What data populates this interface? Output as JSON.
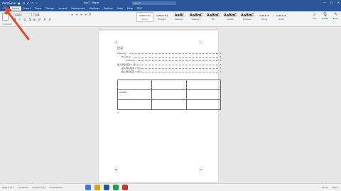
{
  "titlebar": {
    "quick_access": [
      "AutoSave",
      "●",
      "⎌",
      "↶",
      "↷",
      "⌄"
    ],
    "doc_title": "doc2 · Word",
    "search_placeholder": "Search",
    "window_controls": [
      "—",
      "□",
      "✕"
    ]
  },
  "tabs": [
    "File",
    "Home",
    "Insert",
    "Draw",
    "Design",
    "Layout",
    "References",
    "Mailings",
    "Review",
    "View",
    "Help",
    "PDF"
  ],
  "active_tab_index": 1,
  "ribbon": {
    "clipboard_label": "Clipboard",
    "font_name": "Calibri",
    "font_size": "10.5",
    "format_buttons": [
      "B",
      "I",
      "U",
      "S",
      "x₂",
      "x²",
      "A",
      "A"
    ],
    "paragraph_buttons": [
      "≡",
      "≡",
      "≡",
      "≡",
      "¶"
    ],
    "styles": [
      {
        "sample": "AaBbCcDd",
        "name": "Normal",
        "small": true
      },
      {
        "sample": "AaBbCcDd",
        "name": "No Spac.",
        "small": true
      },
      {
        "sample": "AaBl",
        "name": "Heading 1",
        "small": false
      },
      {
        "sample": "AaBbC",
        "name": "Heading 2",
        "small": false
      },
      {
        "sample": "AaBbC",
        "name": "Title",
        "small": false
      },
      {
        "sample": "AaBbC",
        "name": "Subtitle",
        "small": false
      },
      {
        "sample": "AaBbC",
        "name": "Emphasis",
        "small": false
      },
      {
        "sample": "AaBbCcD",
        "name": "Strong",
        "small": true
      },
      {
        "sample": "AaBbCcD",
        "name": "Quote",
        "small": true
      }
    ],
    "right_tools": [
      {
        "icon": "⌕",
        "label": "Find"
      },
      {
        "icon": "🎙",
        "label": "Dictate"
      },
      {
        "icon": "✎",
        "label": "Editor"
      }
    ]
  },
  "document": {
    "toc_title": "目录",
    "toc_lines": [
      {
        "text": "Heading",
        "indent": 0,
        "num": "1"
      },
      {
        "text": "Heading",
        "indent": 6,
        "num": "1"
      },
      {
        "text": "Heading",
        "indent": 12,
        "num": "1"
      },
      {
        "text": "插入题注段落 1 (无)",
        "indent": 0,
        "num": "1"
      },
      {
        "text": "插入题注段落 2 (无)",
        "indent": 6,
        "num": "1"
      },
      {
        "text": "插入题注段落 3 (无)",
        "indent": 6,
        "num": "1"
      }
    ],
    "table_rows": [
      [
        "",
        "",
        ""
      ],
      [
        "123456",
        "",
        ""
      ],
      [
        "",
        "",
        ""
      ]
    ]
  },
  "statusbar": {
    "left": [
      "Page 1 of 1",
      "45 words",
      "English (US)",
      "Accessibility"
    ],
    "right": [
      "Focus",
      "100%"
    ]
  }
}
